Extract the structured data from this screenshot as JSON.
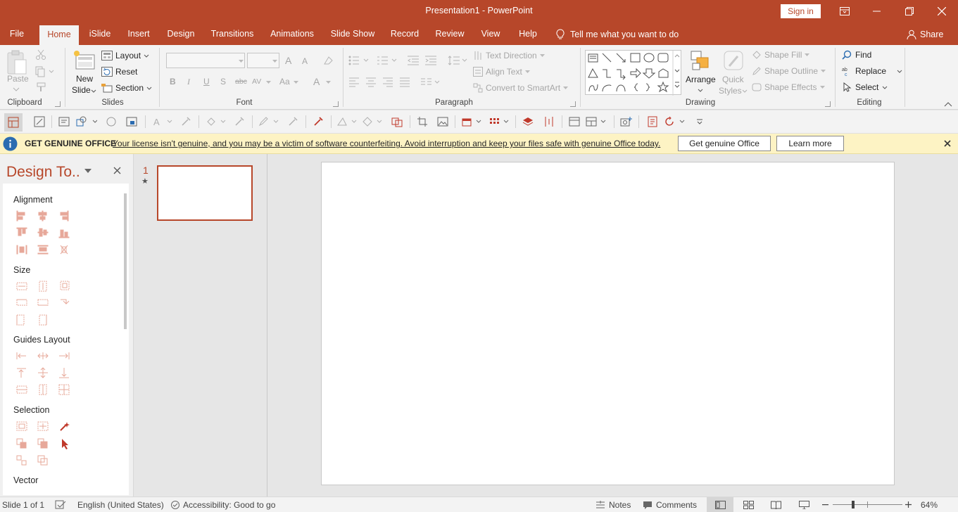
{
  "window": {
    "title": "Presentation1  -  PowerPoint",
    "sign_in": "Sign in"
  },
  "tabs": [
    "File",
    "Home",
    "iSlide",
    "Insert",
    "Design",
    "Transitions",
    "Animations",
    "Slide Show",
    "Record",
    "Review",
    "View",
    "Help"
  ],
  "active_tab": "Home",
  "tell_me": "Tell me what you want to do",
  "share": "Share",
  "ribbon": {
    "clipboard": {
      "paste": "Paste",
      "label": "Clipboard"
    },
    "slides": {
      "new_slide_1": "New",
      "new_slide_2": "Slide",
      "layout": "Layout",
      "reset": "Reset",
      "section": "Section",
      "label": "Slides"
    },
    "font": {
      "label": "Font",
      "bold": "B",
      "italic": "I",
      "underline": "U",
      "shadow": "S",
      "strike": "abc",
      "spacing": "AV",
      "case": "Aa",
      "color": "A",
      "grow": "A",
      "shrink": "A"
    },
    "paragraph": {
      "label": "Paragraph",
      "text_direction": "Text Direction",
      "align_text": "Align Text",
      "convert_smartart": "Convert to SmartArt"
    },
    "drawing": {
      "label": "Drawing",
      "arrange": "Arrange",
      "quick_styles_1": "Quick",
      "quick_styles_2": "Styles",
      "shape_fill": "Shape Fill",
      "shape_outline": "Shape Outline",
      "shape_effects": "Shape Effects"
    },
    "editing": {
      "label": "Editing",
      "find": "Find",
      "replace": "Replace",
      "select": "Select"
    }
  },
  "notice": {
    "title": "GET GENUINE OFFICE",
    "message": "Your license isn't genuine, and you may be a victim of software counterfeiting. Avoid interruption and keep your files safe with genuine Office today.",
    "btn_genuine": "Get genuine Office",
    "btn_learn": "Learn more"
  },
  "design_tools": {
    "title": "Design To..",
    "sections": [
      "Alignment",
      "Size",
      "Guides Layout",
      "Selection",
      "Vector"
    ]
  },
  "thumbnails": [
    {
      "number": "1",
      "marker": "★"
    }
  ],
  "status": {
    "slide": "Slide 1 of 1",
    "language": "English (United States)",
    "accessibility": "Accessibility: Good to go",
    "notes": "Notes",
    "comments": "Comments",
    "zoom": "64%"
  },
  "colors": {
    "accent": "#b7472a",
    "notice_bg": "#fdf3c4",
    "disabled_icon": "#e7a89a"
  }
}
